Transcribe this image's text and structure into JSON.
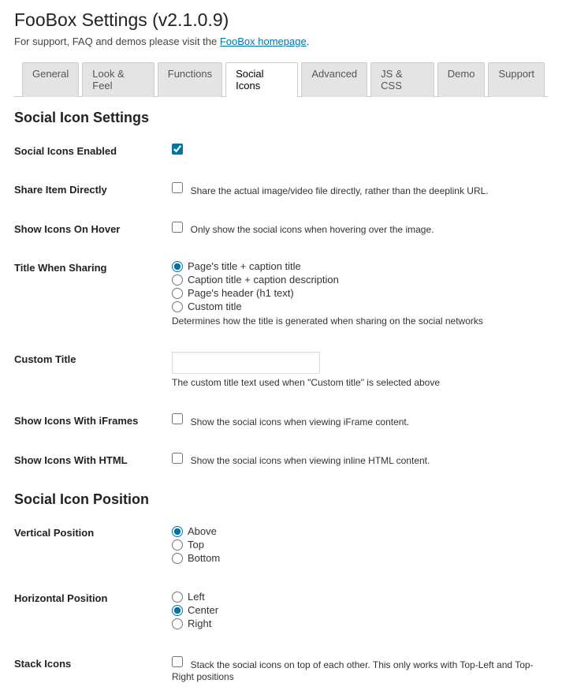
{
  "page": {
    "title": "FooBox Settings (v2.1.0.9)",
    "support_prefix": "For support, FAQ and demos please visit the ",
    "support_link": "FooBox homepage",
    "support_suffix": "."
  },
  "tabs": [
    "General",
    "Look & Feel",
    "Functions",
    "Social Icons",
    "Advanced",
    "JS & CSS",
    "Demo",
    "Support"
  ],
  "active_tab": "Social Icons",
  "section1": {
    "heading": "Social Icon Settings",
    "enabled": {
      "label": "Social Icons Enabled",
      "checked": true
    },
    "share_direct": {
      "label": "Share Item Directly",
      "checked": false,
      "desc": "Share the actual image/video file directly, rather than the deeplink URL."
    },
    "on_hover": {
      "label": "Show Icons On Hover",
      "checked": false,
      "desc": "Only show the social icons when hovering over the image."
    },
    "title_sharing": {
      "label": "Title When Sharing",
      "options": [
        "Page's title + caption title",
        "Caption title + caption description",
        "Page's header (h1 text)",
        "Custom title"
      ],
      "selected": 0,
      "help": "Determines how the title is generated when sharing on the social networks"
    },
    "custom_title": {
      "label": "Custom Title",
      "value": "",
      "help": "The custom title text used when \"Custom title\" is selected above"
    },
    "with_iframes": {
      "label": "Show Icons With iFrames",
      "checked": false,
      "desc": "Show the social icons when viewing iFrame content."
    },
    "with_html": {
      "label": "Show Icons With HTML",
      "checked": false,
      "desc": "Show the social icons when viewing inline HTML content."
    }
  },
  "section2": {
    "heading": "Social Icon Position",
    "vertical": {
      "label": "Vertical Position",
      "options": [
        "Above",
        "Top",
        "Bottom"
      ],
      "selected": 0
    },
    "horizontal": {
      "label": "Horizontal Position",
      "options": [
        "Left",
        "Center",
        "Right"
      ],
      "selected": 1
    },
    "stack": {
      "label": "Stack Icons",
      "checked": false,
      "desc": "Stack the social icons on top of each other. This only works with Top-Left and Top-Right positions"
    }
  }
}
